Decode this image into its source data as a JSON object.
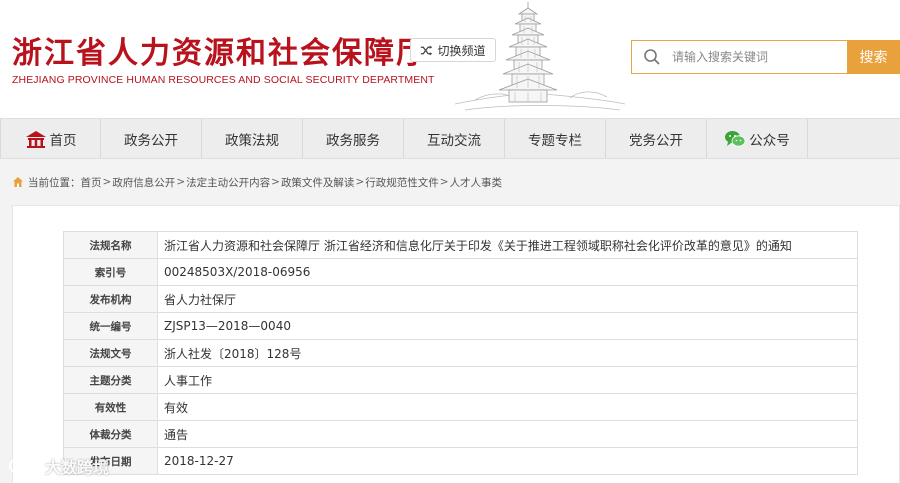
{
  "header": {
    "title_cn": "浙江省人力资源和社会保障厅",
    "title_en": "ZHEJIANG PROVINCE HUMAN RESOURCES AND SOCIAL SECURITY DEPARTMENT",
    "switch_label": "切换频道"
  },
  "search": {
    "placeholder": "请输入搜索关键词",
    "button": "搜索"
  },
  "nav": [
    {
      "label": "首页",
      "icon": "home-icon"
    },
    {
      "label": "政务公开"
    },
    {
      "label": "政策法规"
    },
    {
      "label": "政务服务"
    },
    {
      "label": "互动交流"
    },
    {
      "label": "专题专栏"
    },
    {
      "label": "党务公开"
    },
    {
      "label": "公众号",
      "icon": "wechat-icon"
    }
  ],
  "breadcrumb": {
    "prefix": "当前位置：",
    "items": [
      "首页",
      "政府信息公开",
      "法定主动公开内容",
      "政策文件及解读",
      "行政规范性文件",
      "人才人事类"
    ]
  },
  "info": [
    {
      "key": "法规名称",
      "value": "浙江省人力资源和社会保障厅 浙江省经济和信息化厅关于印发《关于推进工程领域职称社会化评价改革的意见》的通知"
    },
    {
      "key": "索引号",
      "value": "00248503X/2018-06956"
    },
    {
      "key": "发布机构",
      "value": "省人力社保厅"
    },
    {
      "key": "统一编号",
      "value": "ZJSP13—2018—0040"
    },
    {
      "key": "法规文号",
      "value": "浙人社发〔2018〕128号"
    },
    {
      "key": "主题分类",
      "value": "人事工作"
    },
    {
      "key": "有效性",
      "value": "有效"
    },
    {
      "key": "体裁分类",
      "value": "通告"
    },
    {
      "key": "发布日期",
      "value": "2018-12-27"
    }
  ],
  "watermark": "大数跨境",
  "colors": {
    "brand": "#b8121d",
    "accent": "#e9a13b"
  }
}
